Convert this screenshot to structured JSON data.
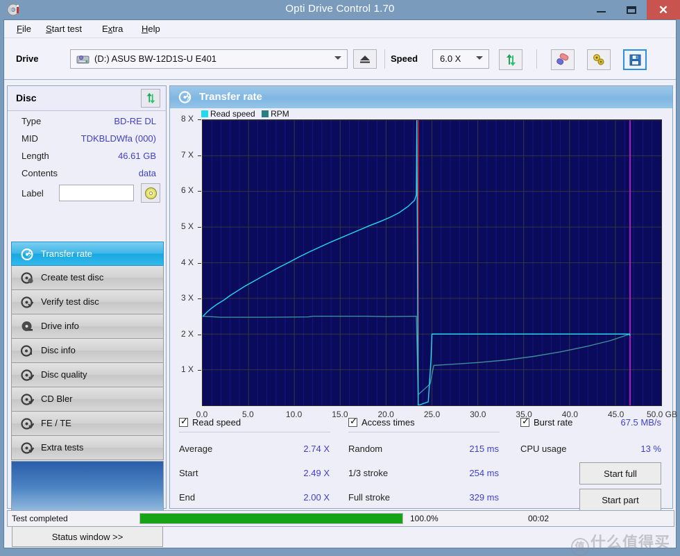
{
  "window": {
    "title": "Opti Drive Control 1.70",
    "icon": "disc-app-icon",
    "buttons": {
      "minimize": "—",
      "maximize": "❐",
      "close": "✕"
    }
  },
  "menu": {
    "items": [
      "File",
      "Start test",
      "Extra",
      "Help"
    ]
  },
  "toolbar": {
    "drive_label": "Drive",
    "drive_value": "(D:)  ASUS BW-12D1S-U E401",
    "eject_icon": "eject-icon",
    "speed_label": "Speed",
    "speed_value": "6.0 X",
    "refresh_icon": "refresh-icon",
    "eraser_icon": "eraser-icon",
    "gears_icon": "gears-icon",
    "save_icon": "save-floppy-icon"
  },
  "disc": {
    "header": "Disc",
    "refresh_icon": "refresh-icon",
    "rows": [
      {
        "key": "Type",
        "value": "BD-RE DL"
      },
      {
        "key": "MID",
        "value": "TDKBLDWfa (000)"
      },
      {
        "key": "Length",
        "value": "46.61 GB"
      },
      {
        "key": "Contents",
        "value": "data"
      }
    ],
    "label_key": "Label",
    "label_value": "",
    "label_placeholder": "",
    "disc_icon": "cd-disc-icon"
  },
  "nav": {
    "items": [
      {
        "label": "Transfer rate",
        "icon": "disc-speed-icon",
        "active": true
      },
      {
        "label": "Create test disc",
        "icon": "disc-create-icon",
        "active": false
      },
      {
        "label": "Verify test disc",
        "icon": "disc-verify-icon",
        "active": false
      },
      {
        "label": "Drive info",
        "icon": "drive-info-icon",
        "active": false
      },
      {
        "label": "Disc info",
        "icon": "disc-info-icon",
        "active": false
      },
      {
        "label": "Disc quality",
        "icon": "disc-quality-icon",
        "active": false
      },
      {
        "label": "CD Bler",
        "icon": "cd-bler-icon",
        "active": false
      },
      {
        "label": "FE / TE",
        "icon": "fe-te-icon",
        "active": false
      },
      {
        "label": "Extra tests",
        "icon": "extra-tests-icon",
        "active": false
      }
    ],
    "status_window_button": "Status window >>"
  },
  "panel": {
    "title": "Transfer rate",
    "icon": "transfer-rate-icon"
  },
  "chart_data": {
    "type": "line",
    "title": "Transfer rate",
    "xlabel": "GB",
    "ylabel": "X",
    "xlim": [
      0,
      50
    ],
    "ylim": [
      0,
      8
    ],
    "x_ticks": [
      "0.0",
      "5.0",
      "10.0",
      "15.0",
      "20.0",
      "25.0",
      "30.0",
      "35.0",
      "40.0",
      "45.0",
      "50.0 GB"
    ],
    "x_tick_values": [
      0,
      5,
      10,
      15,
      20,
      25,
      30,
      35,
      40,
      45,
      50
    ],
    "y_ticks": [
      "1 X",
      "2 X",
      "3 X",
      "4 X",
      "5 X",
      "6 X",
      "7 X",
      "8 X"
    ],
    "y_tick_values": [
      1,
      2,
      3,
      4,
      5,
      6,
      7,
      8
    ],
    "grid": true,
    "legend": [
      {
        "name": "Read speed",
        "color": "#22d9f0"
      },
      {
        "name": "RPM",
        "color": "#2a7d84"
      }
    ],
    "plot_bg": "#0b0b5c",
    "series": [
      {
        "name": "Read speed",
        "color": "#22d9f0",
        "points": [
          [
            0.0,
            2.49
          ],
          [
            0.5,
            2.62
          ],
          [
            1.0,
            2.73
          ],
          [
            1.6,
            2.84
          ],
          [
            2.3,
            2.95
          ],
          [
            3.0,
            3.08
          ],
          [
            3.8,
            3.21
          ],
          [
            4.6,
            3.34
          ],
          [
            5.5,
            3.47
          ],
          [
            6.4,
            3.6
          ],
          [
            7.4,
            3.74
          ],
          [
            8.4,
            3.88
          ],
          [
            9.4,
            4.01
          ],
          [
            10.5,
            4.16
          ],
          [
            11.6,
            4.3
          ],
          [
            12.7,
            4.43
          ],
          [
            13.8,
            4.56
          ],
          [
            14.9,
            4.68
          ],
          [
            16.0,
            4.8
          ],
          [
            17.1,
            4.92
          ],
          [
            18.2,
            5.04
          ],
          [
            19.3,
            5.15
          ],
          [
            20.4,
            5.27
          ],
          [
            21.4,
            5.4
          ],
          [
            22.4,
            5.58
          ],
          [
            23.1,
            5.75
          ],
          [
            23.3,
            5.9
          ],
          [
            23.35,
            8.0
          ],
          [
            23.5,
            0.0
          ],
          [
            24.6,
            0.1
          ],
          [
            24.9,
            1.3
          ],
          [
            25.0,
            2.0
          ],
          [
            30.0,
            2.0
          ],
          [
            35.0,
            2.0
          ],
          [
            40.0,
            2.0
          ],
          [
            45.0,
            2.0
          ],
          [
            46.55,
            2.0
          ],
          [
            46.6,
            1.95
          ]
        ]
      },
      {
        "name": "RPM",
        "color": "#3f8d98",
        "points": [
          [
            0.0,
            2.5
          ],
          [
            2.0,
            2.47
          ],
          [
            6.0,
            2.47
          ],
          [
            11.5,
            2.48
          ],
          [
            12.0,
            2.5
          ],
          [
            18.0,
            2.5
          ],
          [
            20.0,
            2.49
          ],
          [
            23.3,
            2.5
          ],
          [
            23.5,
            0.3
          ],
          [
            24.8,
            0.6
          ],
          [
            25.2,
            1.12
          ],
          [
            27.0,
            1.15
          ],
          [
            30.0,
            1.2
          ],
          [
            33.0,
            1.27
          ],
          [
            36.0,
            1.37
          ],
          [
            39.0,
            1.5
          ],
          [
            42.0,
            1.66
          ],
          [
            44.5,
            1.82
          ],
          [
            46.0,
            1.95
          ],
          [
            46.6,
            2.0
          ]
        ]
      }
    ],
    "markers": [
      {
        "name": "layer-break-marker",
        "x": 23.5,
        "color": "#e01020"
      },
      {
        "name": "disc-end-marker",
        "x": 46.6,
        "color": "#cc22cc"
      }
    ]
  },
  "stats": {
    "read_speed": {
      "checkbox_label": "Read speed",
      "checked": true,
      "rows": [
        {
          "key": "Average",
          "value": "2.74 X"
        },
        {
          "key": "Start",
          "value": "2.49 X"
        },
        {
          "key": "End",
          "value": "2.00 X"
        }
      ]
    },
    "access_times": {
      "checkbox_label": "Access times",
      "checked": true,
      "rows": [
        {
          "key": "Random",
          "value": "215 ms"
        },
        {
          "key": "1/3 stroke",
          "value": "254 ms"
        },
        {
          "key": "Full stroke",
          "value": "329 ms"
        }
      ]
    },
    "burst_rate": {
      "checkbox_label": "Burst rate",
      "checked": true,
      "value": "67.5 MB/s",
      "rows": [
        {
          "key": "CPU usage",
          "value": "13 %"
        }
      ]
    },
    "buttons": {
      "start_full": "Start full",
      "start_part": "Start part"
    }
  },
  "statusbar": {
    "message": "Test completed",
    "progress_percent": "100.0%",
    "progress_value": 100,
    "elapsed": "00:02"
  },
  "watermark": {
    "text": "什么值得买"
  }
}
